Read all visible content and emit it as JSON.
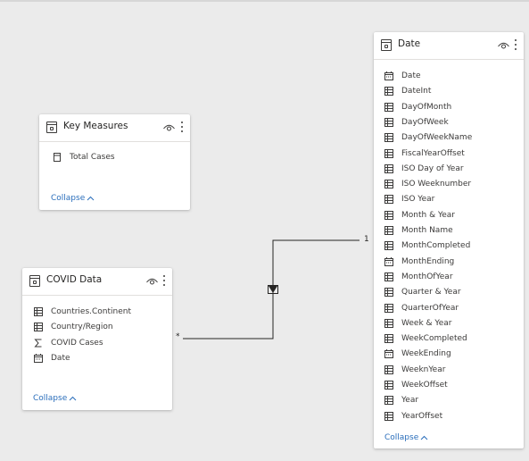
{
  "tables": {
    "key_measures": {
      "title": "Key Measures",
      "fields": [
        {
          "label": "Total Cases",
          "icon": "calculator-icon"
        }
      ],
      "collapse_label": "Collapse"
    },
    "covid_data": {
      "title": "COVID Data",
      "fields": [
        {
          "label": "Countries.Continent",
          "icon": "table-column-icon"
        },
        {
          "label": "Country/Region",
          "icon": "table-column-icon"
        },
        {
          "label": "COVID Cases",
          "icon": "sigma-icon"
        },
        {
          "label": "Date",
          "icon": "calendar-icon"
        }
      ],
      "collapse_label": "Collapse"
    },
    "date": {
      "title": "Date",
      "fields": [
        {
          "label": "Date",
          "icon": "calendar-icon"
        },
        {
          "label": "DateInt",
          "icon": "table-column-icon"
        },
        {
          "label": "DayOfMonth",
          "icon": "table-column-icon"
        },
        {
          "label": "DayOfWeek",
          "icon": "table-column-icon"
        },
        {
          "label": "DayOfWeekName",
          "icon": "table-column-icon"
        },
        {
          "label": "FiscalYearOffset",
          "icon": "table-column-icon"
        },
        {
          "label": "ISO Day of Year",
          "icon": "table-column-icon"
        },
        {
          "label": "ISO Weeknumber",
          "icon": "table-column-icon"
        },
        {
          "label": "ISO Year",
          "icon": "table-column-icon"
        },
        {
          "label": "Month & Year",
          "icon": "table-column-icon"
        },
        {
          "label": "Month Name",
          "icon": "table-column-icon"
        },
        {
          "label": "MonthCompleted",
          "icon": "table-column-icon"
        },
        {
          "label": "MonthEnding",
          "icon": "calendar-icon"
        },
        {
          "label": "MonthOfYear",
          "icon": "table-column-icon"
        },
        {
          "label": "Quarter & Year",
          "icon": "table-column-icon"
        },
        {
          "label": "QuarterOfYear",
          "icon": "table-column-icon"
        },
        {
          "label": "Week & Year",
          "icon": "table-column-icon"
        },
        {
          "label": "WeekCompleted",
          "icon": "table-column-icon"
        },
        {
          "label": "WeekEnding",
          "icon": "calendar-icon"
        },
        {
          "label": "WeeknYear",
          "icon": "table-column-icon"
        },
        {
          "label": "WeekOffset",
          "icon": "table-column-icon"
        },
        {
          "label": "Year",
          "icon": "table-column-icon"
        },
        {
          "label": "YearOffset",
          "icon": "table-column-icon"
        }
      ],
      "collapse_label": "Collapse"
    }
  },
  "relationship": {
    "one_side_label": "1",
    "many_side_label": "*",
    "filter_direction": "single"
  },
  "colors": {
    "canvas": "#ebebeb",
    "card": "#ffffff",
    "link": "#2a6ebb",
    "line": "#252423"
  }
}
